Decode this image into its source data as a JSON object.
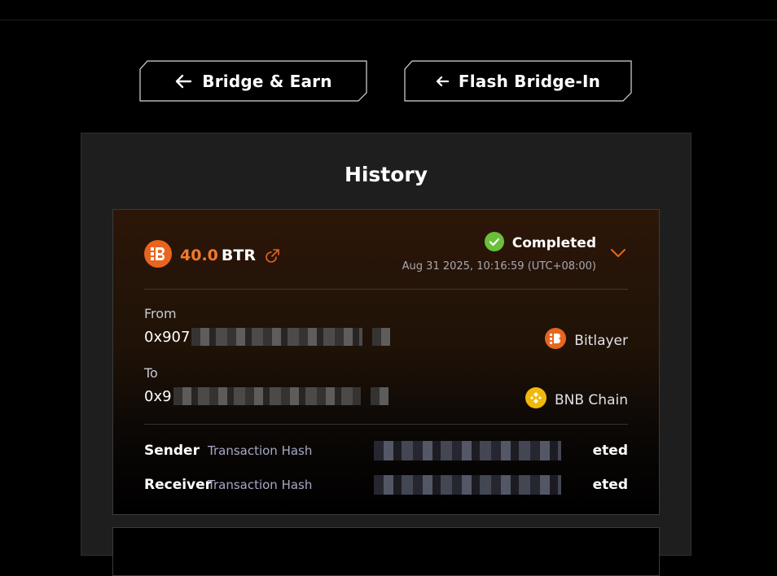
{
  "nav": {
    "bridge_earn_label": "Bridge & Earn",
    "flash_bridge_label": "Flash Bridge-In"
  },
  "history": {
    "title": "History",
    "item": {
      "amount": "40.0",
      "symbol": "BTR",
      "status": "Completed",
      "timestamp": "Aug 31 2025, 10:16:59 (UTC+08:00)",
      "from_label": "From",
      "from_address_prefix": "0x907",
      "from_chain": "Bitlayer",
      "to_label": "To",
      "to_address_prefix": "0x9",
      "to_chain": "BNB Chain",
      "sender_label": "Sender",
      "sender_hash_label": "Transaction Hash",
      "sender_status": "eted",
      "receiver_label": "Receiver",
      "receiver_hash_label": "Transaction Hash",
      "receiver_status": "eted"
    }
  },
  "colors": {
    "accent": "#f07a2a",
    "success": "#6bbf3a",
    "bnb": "#f0b90b"
  }
}
